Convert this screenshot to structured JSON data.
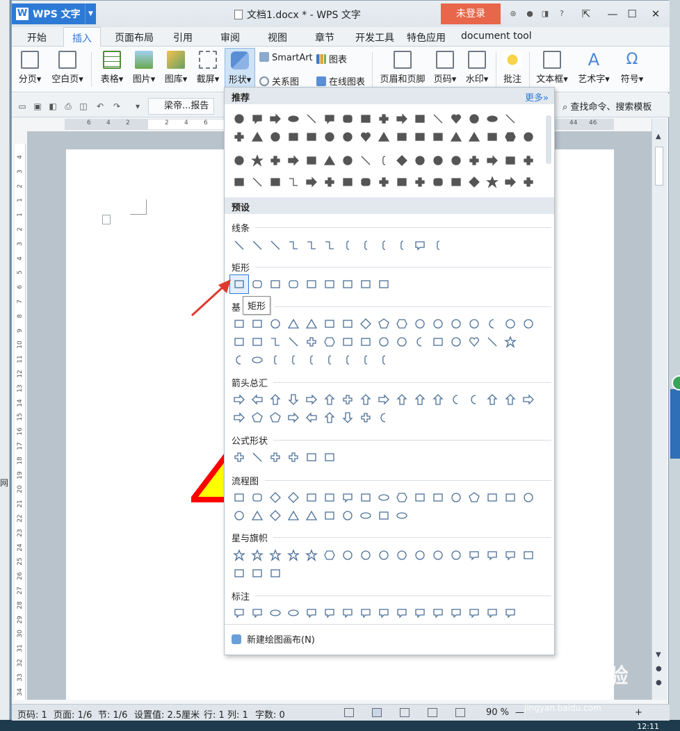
{
  "window": {
    "app_name": "WPS 文字",
    "doc_title": "文档1.docx * - WPS 文字",
    "login_label": "未登录"
  },
  "menu": {
    "tabs": [
      "开始",
      "插入",
      "页面布局",
      "引用",
      "审阅",
      "视图",
      "章节",
      "开发工具",
      "特色应用",
      "document tool"
    ],
    "active": "插入"
  },
  "ribbon": {
    "page_break": "分页",
    "blank_page": "空白页",
    "table": "表格",
    "picture": "图片",
    "gallery": "图库",
    "screenshot": "截屏",
    "shapes": "形状",
    "smartart": "SmartArt",
    "chart": "图表",
    "relation": "关系图",
    "online_chart": "在线图表",
    "header_footer": "页眉和页脚",
    "page_number": "页码",
    "watermark": "水印",
    "comment": "批注",
    "textbox": "文本框",
    "wordart": "艺术字",
    "symbol": "符号"
  },
  "quickbar": {
    "doc_tab": "梁帝...报告",
    "search": "查找命令、搜索模板"
  },
  "panel": {
    "recommended": "推荐",
    "more": "更多»",
    "presets": "预设",
    "lines": "线条",
    "rectangles": "矩形",
    "basic": "基",
    "arrows": "箭头总汇",
    "equation": "公式形状",
    "flowchart": "流程图",
    "stars": "星与旗帜",
    "callouts": "标注",
    "tooltip": "矩形",
    "new_canvas": "新建绘图画布(N)"
  },
  "ruler": {
    "h_numbers": [
      "6",
      "4",
      "2",
      "2",
      "4",
      "6",
      "44",
      "46"
    ],
    "v_numbers": [
      "4",
      "3",
      "2",
      "1",
      "1",
      "2",
      "3",
      "4",
      "5",
      "6",
      "7",
      "8",
      "9",
      "10",
      "11",
      "12",
      "13",
      "14",
      "15",
      "16",
      "17",
      "18",
      "19",
      "20",
      "21",
      "22",
      "23",
      "24",
      "25",
      "26",
      "27",
      "28",
      "29",
      "30",
      "31",
      "32",
      "33",
      "34"
    ]
  },
  "status": {
    "page_code": "页码: 1",
    "page": "页面: 1/6",
    "section": "节: 1/6",
    "setting": "设置值: 2.5厘米",
    "row": "行: 1",
    "col": "列: 1",
    "words": "字数: 0",
    "zoom": "90 %"
  },
  "desktop": {
    "side_text": "网",
    "clock": "12:11",
    "watermark": "Baidu 经验",
    "watermark_sub": "jingyan.baidu.com"
  },
  "colors": {
    "accent": "#2d7ad6",
    "login": "#e8674a",
    "shape_stroke": "#4a6f96",
    "red_arrow": "#e03a2e",
    "triangle_fill": "#ffff00",
    "triangle_stroke": "#ff0000"
  }
}
